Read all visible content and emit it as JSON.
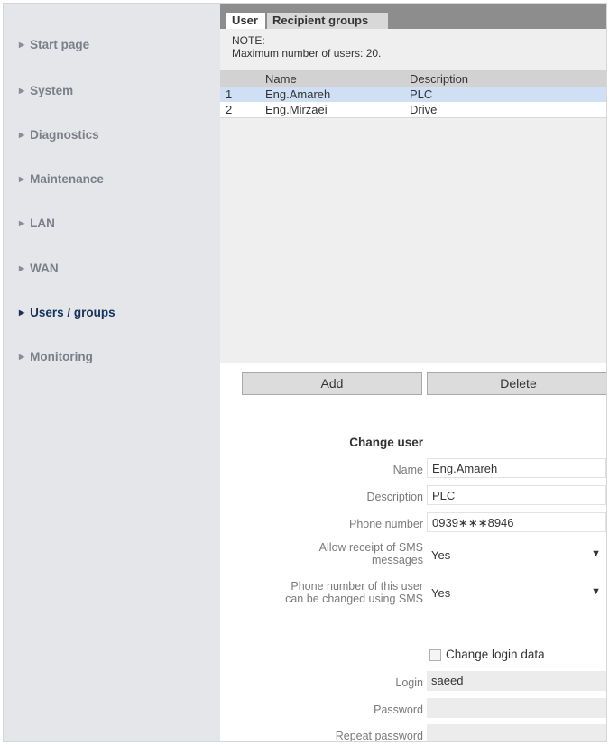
{
  "sidebar": {
    "items": [
      {
        "label": "Start page",
        "active": false
      },
      {
        "label": "System",
        "active": false
      },
      {
        "label": "Diagnostics",
        "active": false
      },
      {
        "label": "Maintenance",
        "active": false
      },
      {
        "label": "LAN",
        "active": false
      },
      {
        "label": "WAN",
        "active": false
      },
      {
        "label": "Users / groups",
        "active": true
      },
      {
        "label": "Monitoring",
        "active": false
      }
    ]
  },
  "tabs": [
    {
      "label": "User",
      "selected": true
    },
    {
      "label": "Recipient groups",
      "selected": false
    }
  ],
  "note": {
    "line1": "NOTE:",
    "line2": "Maximum number of users: 20."
  },
  "table": {
    "headers": [
      "",
      "Name",
      "Description"
    ],
    "rows": [
      {
        "index": "1",
        "name": "Eng.Amareh",
        "description": "PLC",
        "selected": true
      },
      {
        "index": "2",
        "name": "Eng.Mirzaei",
        "description": "Drive",
        "selected": false
      }
    ]
  },
  "buttons": {
    "add": "Add",
    "delete": "Delete"
  },
  "change_user": {
    "title": "Change user",
    "name_label": "Name",
    "name_value": "Eng.Amareh",
    "description_label": "Description",
    "description_value": "PLC",
    "phone_label": "Phone number",
    "phone_value": "0939∗∗∗8946",
    "sms_label_1": "Allow receipt of SMS",
    "sms_label_2": "messages",
    "sms_value": "Yes",
    "phone_change_label_1": "Phone number of this user",
    "phone_change_label_2": "can be changed using SMS",
    "phone_change_value": "Yes",
    "change_login_label": "Change login data",
    "change_login_checked": false,
    "login_label": "Login",
    "login_value": "saeed",
    "password_label": "Password",
    "repeat_password_label": "Repeat password"
  },
  "icons": {
    "nav_bullet": "triangle-right-icon",
    "select_caret": "triangle-down-icon"
  },
  "colors": {
    "sidebar_bg": "#e4e6ea",
    "active_nav": "#15325c",
    "selected_row": "#cfe0f5",
    "tab_bar": "#8d8d8d"
  }
}
